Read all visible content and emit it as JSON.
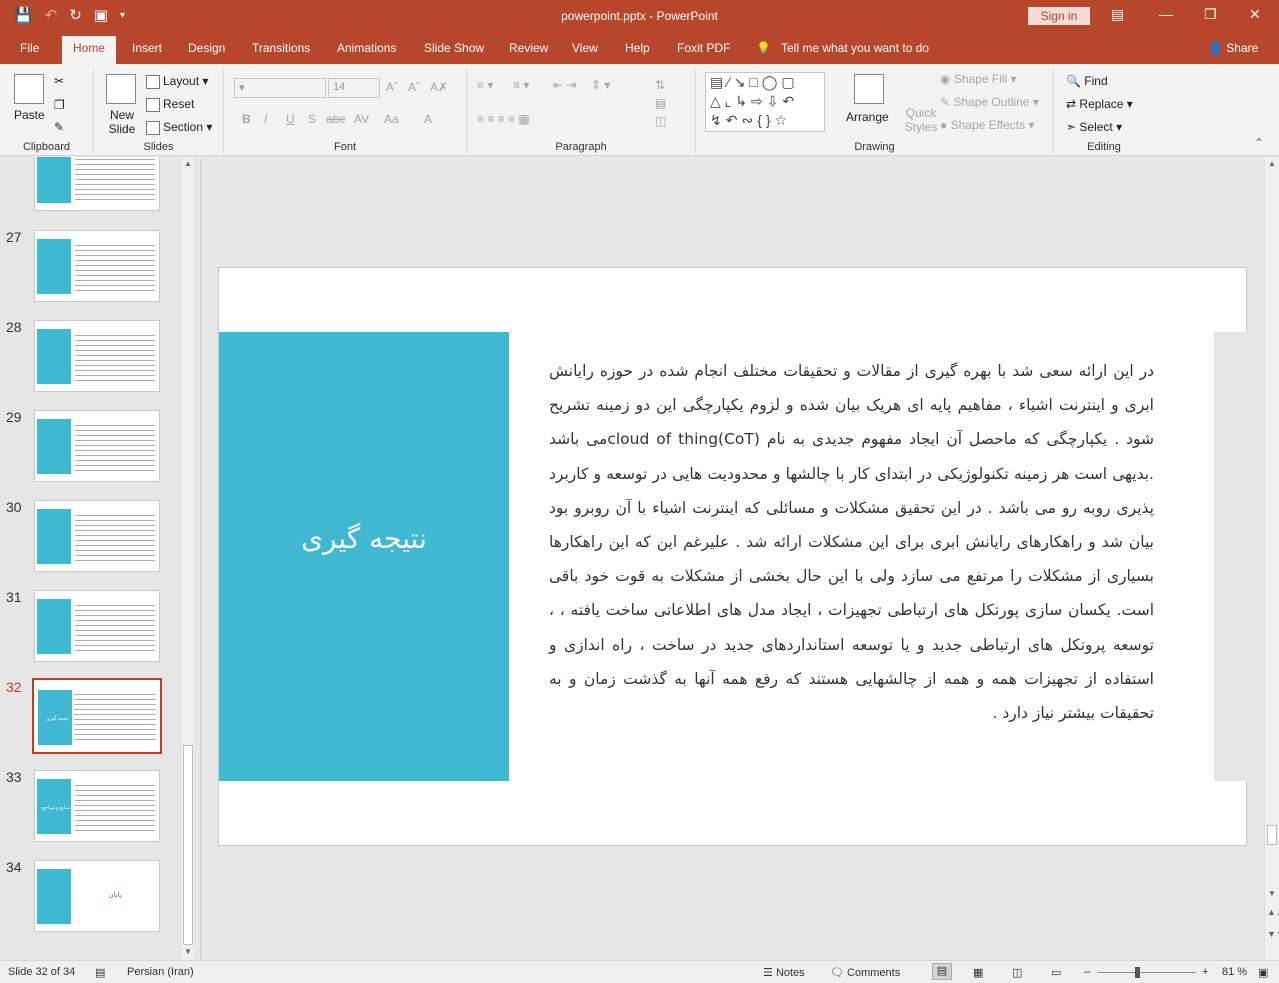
{
  "titlebar": {
    "title": "powerpoint.pptx  -  PowerPoint",
    "sign_in": "Sign in",
    "qat": [
      "save-icon",
      "undo-icon",
      "redo-icon",
      "present-icon",
      "customize-icon"
    ]
  },
  "tabs": [
    "File",
    "Home",
    "Insert",
    "Design",
    "Transitions",
    "Animations",
    "Slide Show",
    "Review",
    "View",
    "Help",
    "Foxit PDF",
    "Tell me what you want to do"
  ],
  "share": "Share",
  "ribbon": {
    "clipboard": {
      "paste": "Paste",
      "label": "Clipboard"
    },
    "slides": {
      "new_slide": "New Slide",
      "layout": "Layout",
      "reset": "Reset",
      "section": "Section",
      "label": "Slides"
    },
    "font": {
      "size": "14",
      "label": "Font",
      "buttons": [
        "B",
        "I",
        "U",
        "S",
        "abc",
        "AV",
        "Aa",
        "A"
      ]
    },
    "paragraph": {
      "label": "Paragraph"
    },
    "drawing": {
      "arrange": "Arrange",
      "quick_styles": "Quick Styles",
      "shape_fill": "Shape Fill",
      "shape_outline": "Shape Outline",
      "shape_effects": "Shape Effects",
      "label": "Drawing"
    },
    "editing": {
      "find": "Find",
      "replace": "Replace",
      "select": "Select",
      "label": "Editing"
    }
  },
  "thumbnails": [
    {
      "num": "",
      "text": ""
    },
    {
      "num": "27",
      "text": ""
    },
    {
      "num": "28",
      "text": ""
    },
    {
      "num": "29",
      "text": ""
    },
    {
      "num": "30",
      "text": ""
    },
    {
      "num": "31",
      "text": ""
    },
    {
      "num": "32",
      "text": "نتیجه گیری"
    },
    {
      "num": "33",
      "text": "منابع و مراجع"
    },
    {
      "num": "34",
      "text": "پایان"
    }
  ],
  "slide": {
    "title": "نتیجه گیری",
    "body": "در این ارائه سعی شد با بهره گیری از مقالات و تحقیقات مختلف انجام شده در حوزه رایانش ابری و اینترنت اشیاء ، مفاهیم پایه ای هریک بیان شده و لزوم یکپارچگی این دو زمینه تشریح شود . یکپارچگی که ماحصل آن ایجاد مفهوم جدیدی به نام  cloud of thing(CoT)می باشد .بدیهی است هر زمینه تکنولوژیکی در ابتدای کار با چالشها و محدودیت هایی در توسعه و کاربرد پذیری روبه رو می باشد . در این تحقیق مشکلات و مسائلی که اینترنت اشیاء با آن روبرو بود بیان شد و راهکارهای رایانش ابری برای این مشکلات ارائه شد . علیرغم این که این راهکارها بسیاری از مشکلات را مرتفع می سازد ولی با این حال بخشی از مشکلات به قوت خود باقی است. یکسان سازی پورتکل های ارتباطی تجهیزات ، ایجاد مدل های اطلاعاتی ساخت یافته ، ، توسعه پروتکل های ارتباطی جدید و یا توسعه استانداردهای جدید در ساخت ، راه اندازی و استفاده از تجهیزات همه و همه از چالشهایی هستند که رفع همه آنها به گذشت زمان و به تحقیقات بیشتر نیاز دارد ."
  },
  "status": {
    "slide_info": "Slide 32 of 34",
    "language": "Persian (Iran)",
    "notes": "Notes",
    "comments": "Comments",
    "zoom": "81 %"
  },
  "colors": {
    "accent": "#b7472a",
    "slide_block": "#3fb8d1"
  }
}
